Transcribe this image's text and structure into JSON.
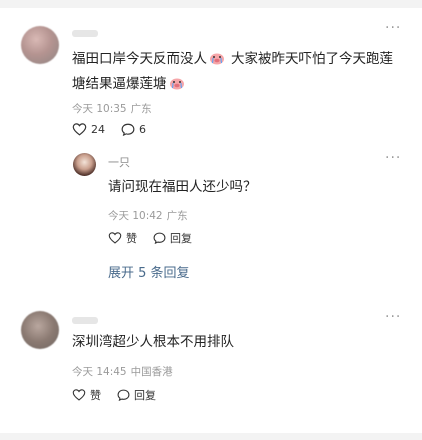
{
  "comments": [
    {
      "text_part1": "福田口岸今天反而没人",
      "text_part2": "大家被昨天吓怕了今天跑莲",
      "text_line2": "塘结果逼爆莲塘",
      "time": "今天 10:35",
      "location": "广东",
      "likes": "24",
      "replies": "6"
    },
    {
      "username": "一只",
      "text": "请问现在福田人还少吗？",
      "time": "今天 10:42",
      "location": "广东",
      "like_label": "赞",
      "reply_label": "回复"
    },
    {
      "text": "深圳湾超少人根本不用排队",
      "time": "今天 14:45",
      "location": "中国香港",
      "like_label": "赞",
      "reply_label": "回复"
    }
  ],
  "expand_label": "展开 5 条回复",
  "more_menu_glyph": "···"
}
